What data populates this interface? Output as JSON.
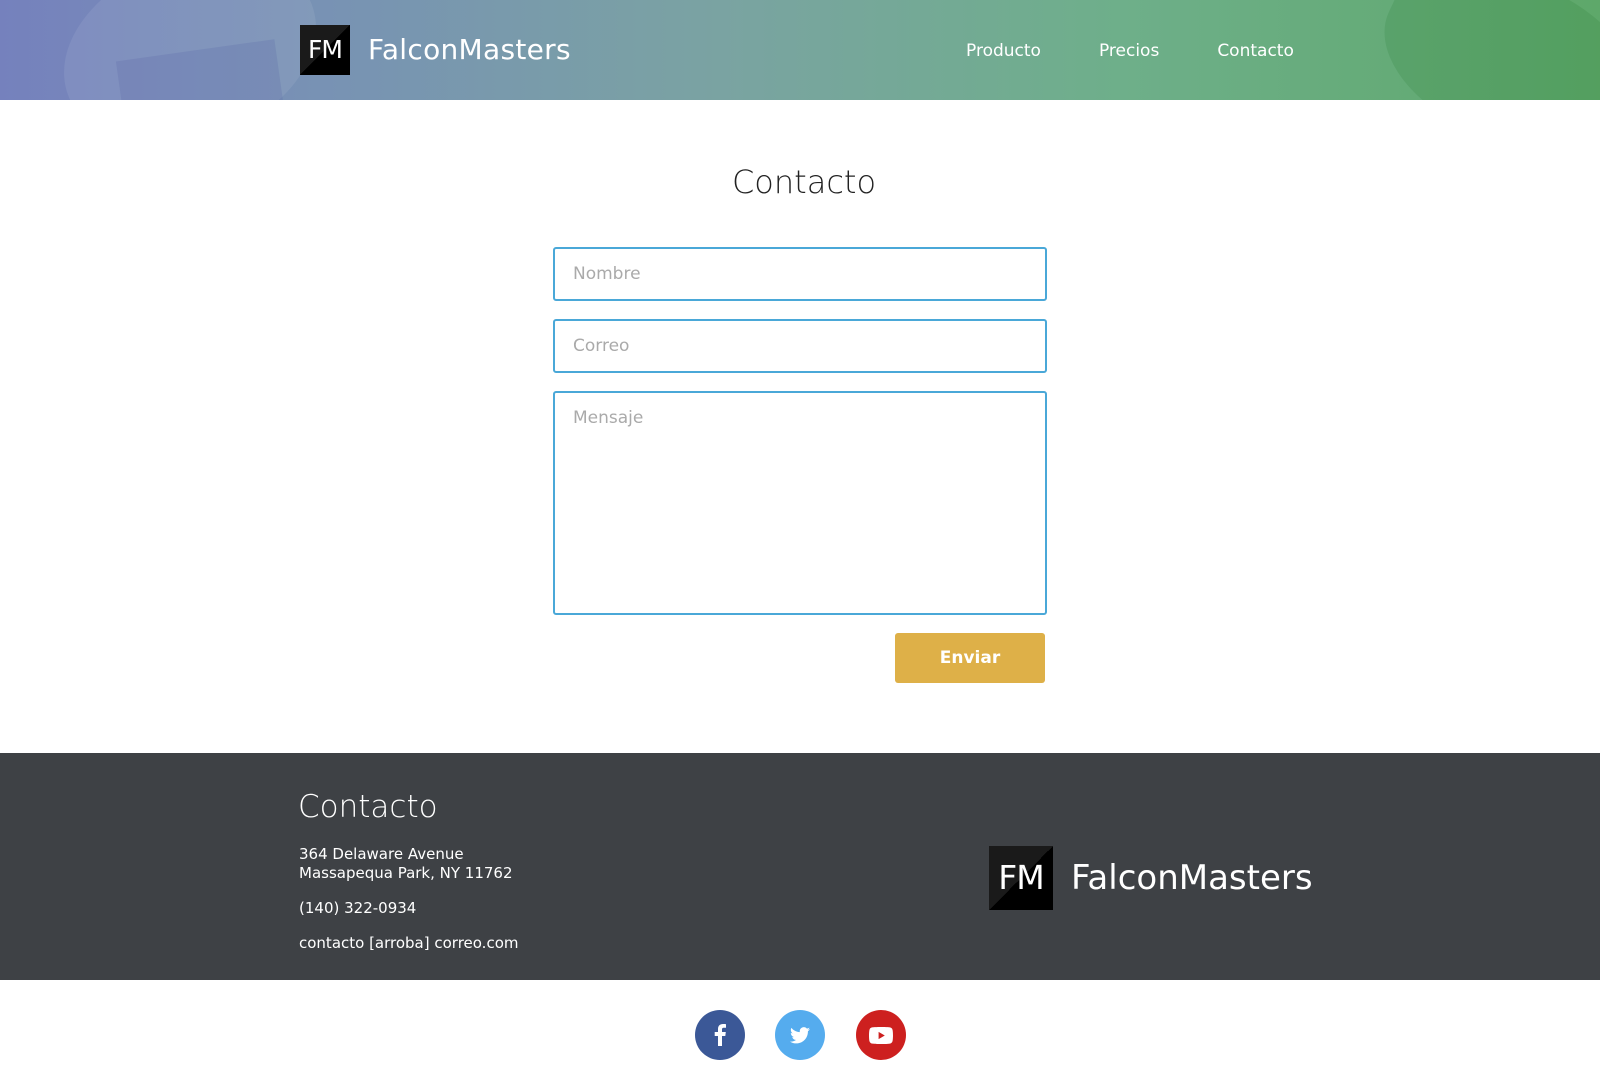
{
  "header": {
    "logo_text": "FM",
    "brand": "FalconMasters",
    "nav": [
      {
        "label": "Producto"
      },
      {
        "label": "Precios"
      },
      {
        "label": "Contacto"
      }
    ]
  },
  "main": {
    "title": "Contacto",
    "form": {
      "name_placeholder": "Nombre",
      "email_placeholder": "Correo",
      "message_placeholder": "Mensaje",
      "submit_label": "Enviar"
    }
  },
  "footer": {
    "title": "Contacto",
    "address_line1": "364 Delaware Avenue",
    "address_line2": "Massapequa Park, NY 11762",
    "phone": "(140) 322-0934",
    "email": "contacto [arroba] correo.com",
    "logo_text": "FM",
    "brand": "FalconMasters"
  },
  "social": {
    "icons": [
      "facebook-icon",
      "twitter-icon",
      "youtube-icon"
    ]
  },
  "colors": {
    "accent_button": "#deb048",
    "input_border": "#4aa8d8",
    "footer_bg": "#3e4145",
    "facebook": "#3b5897",
    "twitter": "#55acee",
    "youtube": "#cd201f"
  }
}
